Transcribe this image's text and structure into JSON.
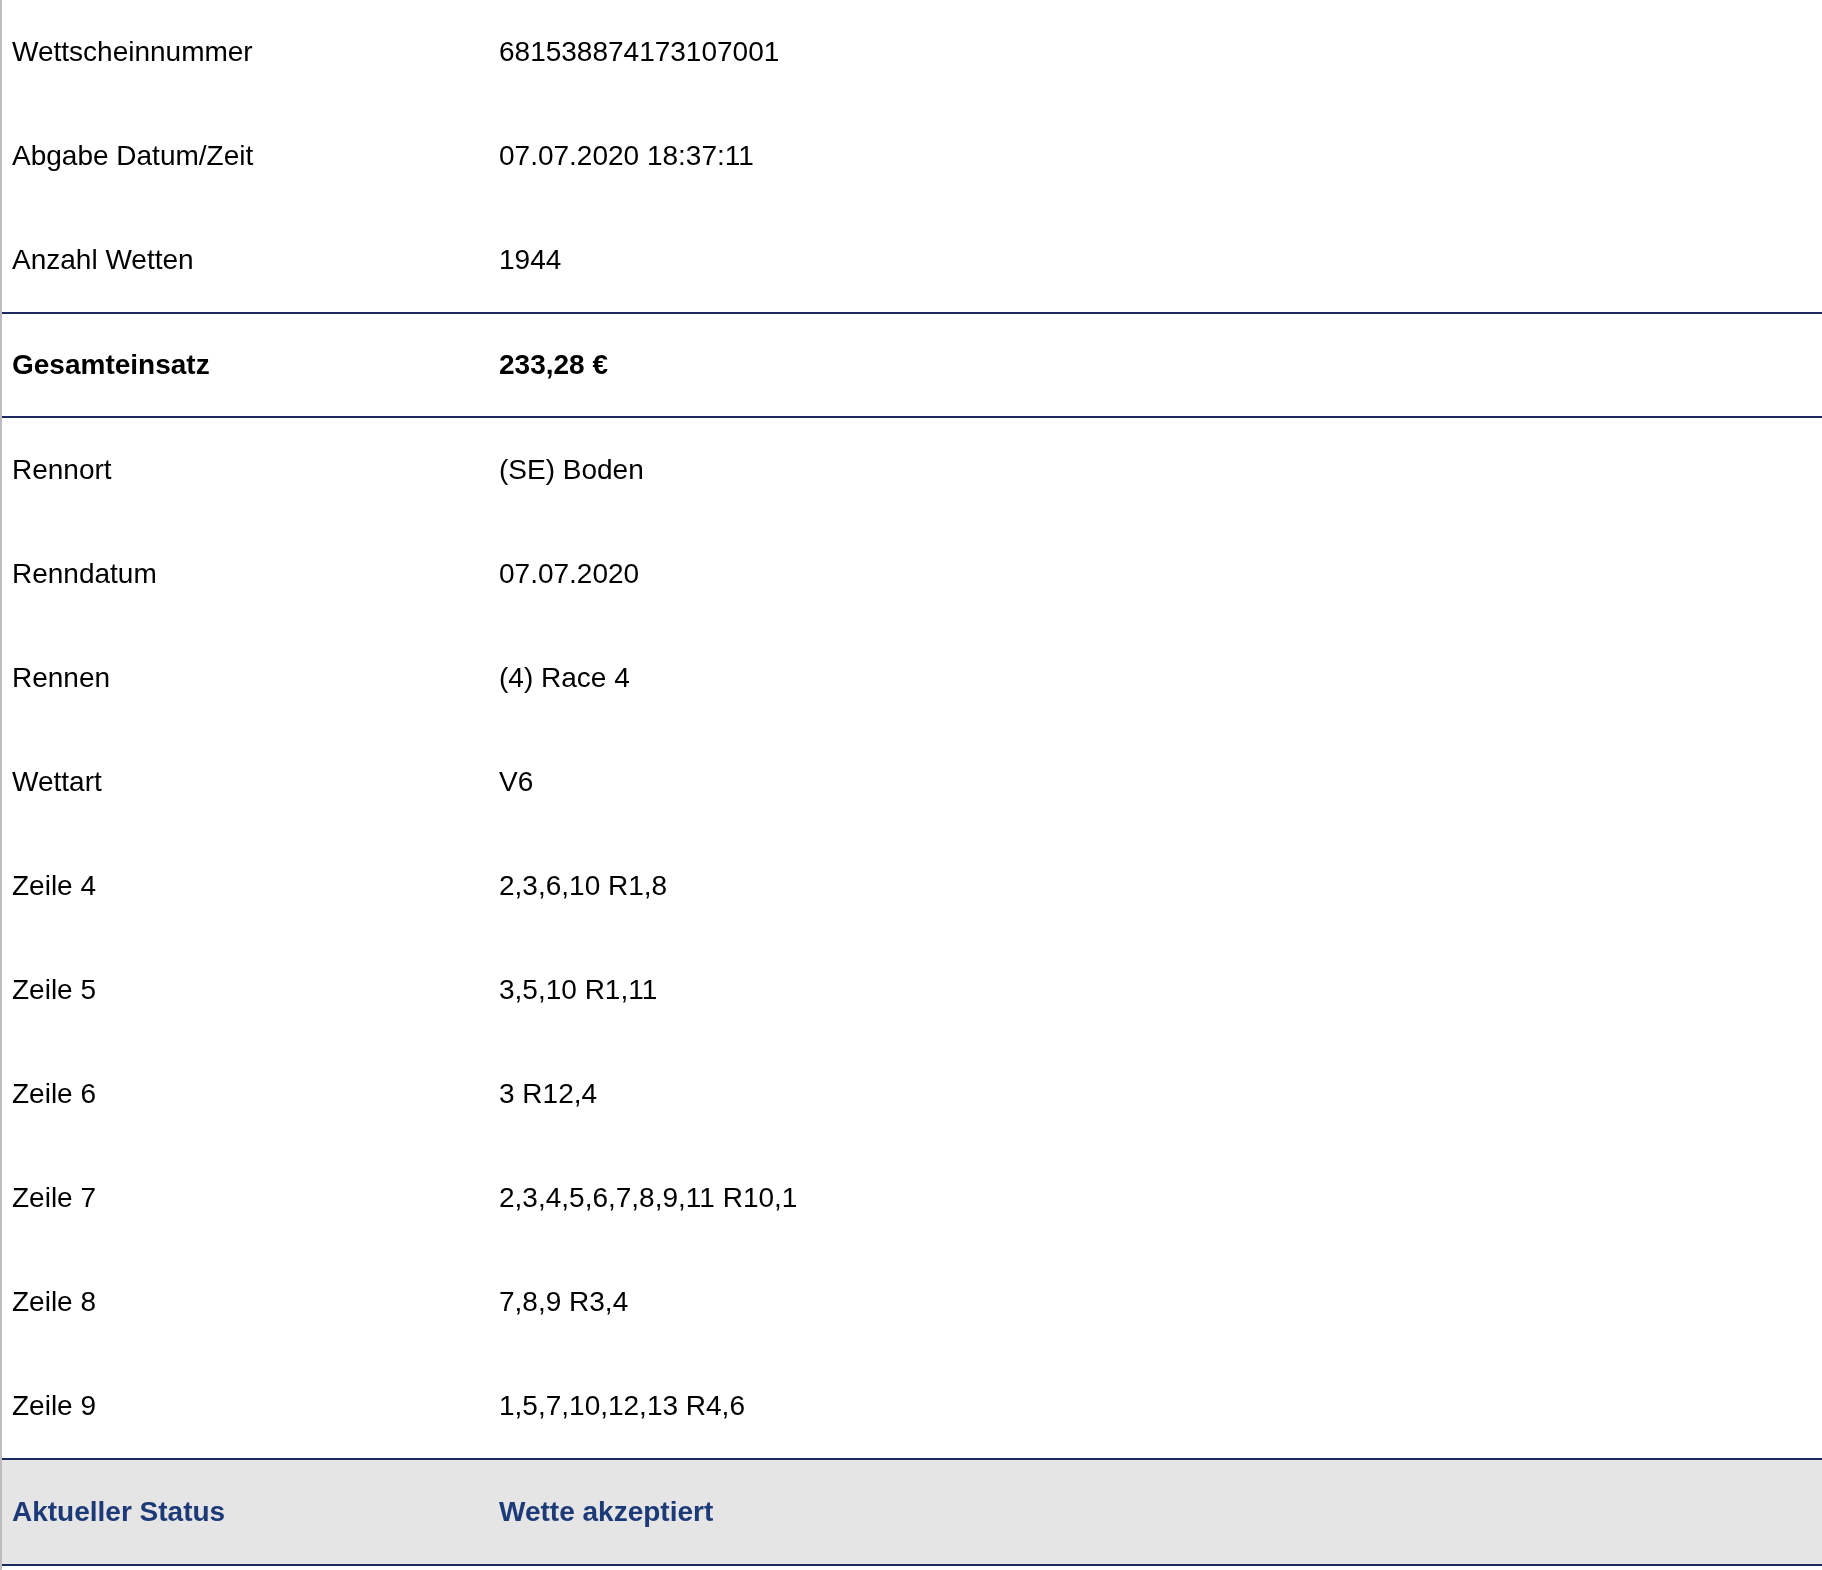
{
  "rows": [
    {
      "kind": "normal",
      "label": "Wettscheinnummer",
      "value": "681538874173107001"
    },
    {
      "kind": "normal",
      "label": "Abgabe Datum/Zeit",
      "value": "07.07.2020 18:37:11"
    },
    {
      "kind": "normal",
      "label": "Anzahl Wetten",
      "value": "1944"
    },
    {
      "kind": "total",
      "label": "Gesamteinsatz",
      "value": "233,28 €"
    },
    {
      "kind": "normal",
      "label": "Rennort",
      "value": "(SE) Boden"
    },
    {
      "kind": "normal",
      "label": "Renndatum",
      "value": "07.07.2020"
    },
    {
      "kind": "normal",
      "label": "Rennen",
      "value": "(4) Race 4"
    },
    {
      "kind": "normal",
      "label": "Wettart",
      "value": "V6"
    },
    {
      "kind": "normal",
      "label": "Zeile 4",
      "value": "2,3,6,10 R1,8"
    },
    {
      "kind": "normal",
      "label": "Zeile 5",
      "value": "3,5,10 R1,11"
    },
    {
      "kind": "normal",
      "label": "Zeile 6",
      "value": "3 R12,4"
    },
    {
      "kind": "normal",
      "label": "Zeile 7",
      "value": "2,3,4,5,6,7,8,9,11 R10,1"
    },
    {
      "kind": "normal",
      "label": "Zeile 8",
      "value": "7,8,9 R3,4"
    },
    {
      "kind": "normal",
      "label": "Zeile 9",
      "value": "1,5,7,10,12,13 R4,6"
    },
    {
      "kind": "status",
      "label": "Aktueller Status",
      "value": "Wette akzeptiert"
    }
  ]
}
